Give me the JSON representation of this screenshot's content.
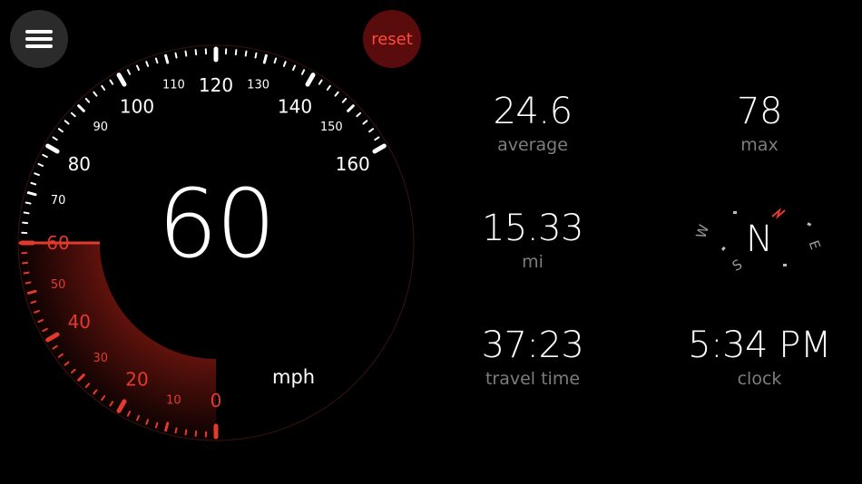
{
  "header": {
    "menu_icon": "hamburger-menu-icon",
    "reset_label": "reset"
  },
  "speedometer": {
    "current_speed": "60",
    "unit": "mph",
    "max_scale": 160,
    "major_labels": [
      "0",
      "20",
      "40",
      "60",
      "80",
      "100",
      "120",
      "140",
      "160"
    ],
    "minor_labels": [
      "10",
      "30",
      "50",
      "70",
      "90",
      "110",
      "130",
      "150"
    ],
    "colors": {
      "active": "#e23b2e",
      "inactive": "#ffffff",
      "glow": "#8a1a12"
    }
  },
  "stats": {
    "average": {
      "value": "24.6",
      "label": "average"
    },
    "max": {
      "value": "78",
      "label": "max"
    },
    "distance": {
      "value": "15.33",
      "label": "mi"
    },
    "travel_time": {
      "value": "37:23",
      "label": "travel time"
    },
    "clock": {
      "value": "5:34 PM",
      "label": "clock"
    }
  },
  "compass": {
    "heading": "N",
    "directions": [
      "N",
      "E",
      "S",
      "W"
    ],
    "icon": "compass-icon"
  }
}
